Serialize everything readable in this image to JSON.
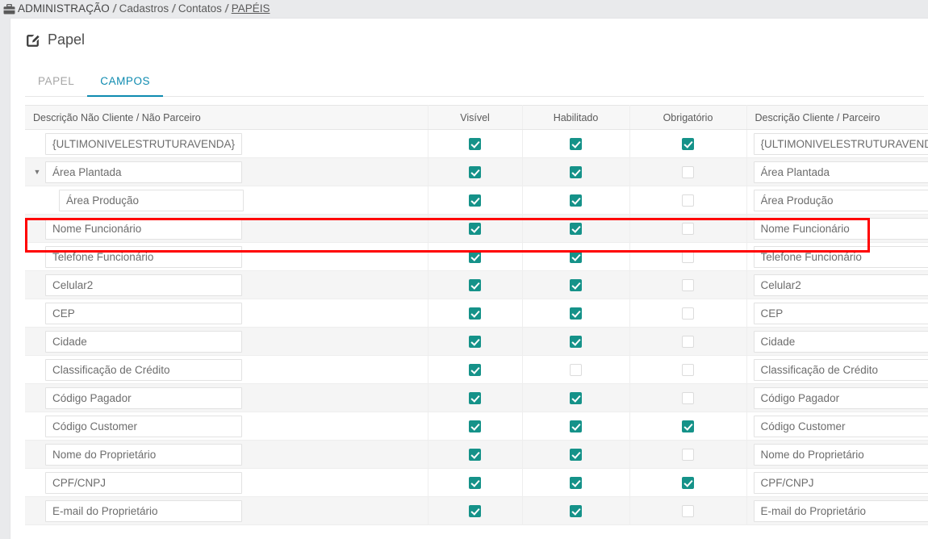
{
  "breadcrumb": {
    "icon": "briefcase-icon",
    "root": "ADMINISTRAÇÃO",
    "sep": "/",
    "items": [
      "Cadastros",
      "Contatos"
    ],
    "current": "PAPÉIS"
  },
  "page": {
    "icon": "edit-square-icon",
    "title": "Papel"
  },
  "tabs": [
    {
      "label": "PAPEL",
      "active": false
    },
    {
      "label": "CAMPOS",
      "active": true
    }
  ],
  "table": {
    "headers": [
      "Descrição Não Cliente / Não Parceiro",
      "Visível",
      "Habilitado",
      "Obrigatório",
      "Descrição Cliente / Parceiro"
    ],
    "rows": [
      {
        "desc_nao_cliente": "{ULTIMONIVELESTRUTURAVENDA}",
        "visivel": true,
        "habilitado": true,
        "obrigatorio": true,
        "desc_cliente": "{ULTIMONIVELESTRUTURAVENDA}",
        "indent": 0,
        "twisty": false,
        "highlighted": false
      },
      {
        "desc_nao_cliente": "Área Plantada",
        "visivel": true,
        "habilitado": true,
        "obrigatorio": false,
        "desc_cliente": "Área Plantada",
        "indent": 0,
        "twisty": true,
        "highlighted": false
      },
      {
        "desc_nao_cliente": "Área Produção",
        "visivel": true,
        "habilitado": true,
        "obrigatorio": false,
        "desc_cliente": "Área Produção",
        "indent": 1,
        "twisty": false,
        "highlighted": true
      },
      {
        "desc_nao_cliente": "Nome Funcionário",
        "visivel": true,
        "habilitado": true,
        "obrigatorio": false,
        "desc_cliente": "Nome Funcionário",
        "indent": 0,
        "twisty": false,
        "highlighted": false
      },
      {
        "desc_nao_cliente": "Telefone Funcionário",
        "visivel": true,
        "habilitado": true,
        "obrigatorio": false,
        "desc_cliente": "Telefone Funcionário",
        "indent": 0,
        "twisty": false,
        "highlighted": false
      },
      {
        "desc_nao_cliente": "Celular2",
        "visivel": true,
        "habilitado": true,
        "obrigatorio": false,
        "desc_cliente": "Celular2",
        "indent": 0,
        "twisty": false,
        "highlighted": false
      },
      {
        "desc_nao_cliente": "CEP",
        "visivel": true,
        "habilitado": true,
        "obrigatorio": false,
        "desc_cliente": "CEP",
        "indent": 0,
        "twisty": false,
        "highlighted": false
      },
      {
        "desc_nao_cliente": "Cidade",
        "visivel": true,
        "habilitado": true,
        "obrigatorio": false,
        "desc_cliente": "Cidade",
        "indent": 0,
        "twisty": false,
        "highlighted": false
      },
      {
        "desc_nao_cliente": "Classificação de Crédito",
        "visivel": true,
        "habilitado": false,
        "obrigatorio": false,
        "desc_cliente": "Classificação de Crédito",
        "indent": 0,
        "twisty": false,
        "highlighted": false
      },
      {
        "desc_nao_cliente": "Código Pagador",
        "visivel": true,
        "habilitado": true,
        "obrigatorio": false,
        "desc_cliente": "Código Pagador",
        "indent": 0,
        "twisty": false,
        "highlighted": false
      },
      {
        "desc_nao_cliente": "Código Customer",
        "visivel": true,
        "habilitado": true,
        "obrigatorio": true,
        "desc_cliente": "Código Customer",
        "indent": 0,
        "twisty": false,
        "highlighted": false
      },
      {
        "desc_nao_cliente": "Nome do Proprietário",
        "visivel": true,
        "habilitado": true,
        "obrigatorio": false,
        "desc_cliente": "Nome do Proprietário",
        "indent": 0,
        "twisty": false,
        "highlighted": false
      },
      {
        "desc_nao_cliente": "CPF/CNPJ",
        "visivel": true,
        "habilitado": true,
        "obrigatorio": true,
        "desc_cliente": "CPF/CNPJ",
        "indent": 0,
        "twisty": false,
        "highlighted": false
      },
      {
        "desc_nao_cliente": "E-mail do Proprietário",
        "visivel": true,
        "habilitado": true,
        "obrigatorio": false,
        "desc_cliente": "E-mail do Proprietário",
        "indent": 0,
        "twisty": false,
        "highlighted": false
      }
    ]
  },
  "colors": {
    "checkbox_on": "#159289",
    "tab_active": "#0e8bb0",
    "highlight_border": "#ff0000",
    "page_background": "#e9eaec"
  }
}
